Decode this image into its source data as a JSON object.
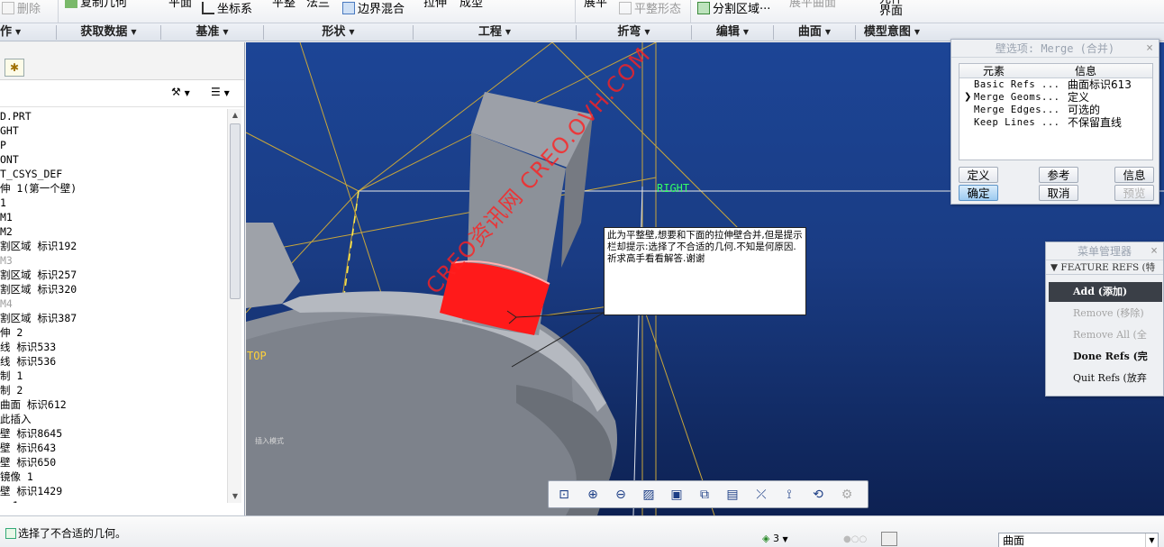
{
  "ribbon": {
    "delete": "删除",
    "copy_geometry": "复制几何",
    "plane": "平面",
    "csys": "坐标系",
    "flat": "平整",
    "method": "法兰",
    "boundary_blend": "边界混合",
    "extrude": "拉伸",
    "form": "成型",
    "bend": "展平",
    "flat_form": "平整形态",
    "split_region": "分割区域···",
    "unbend": "展平曲面",
    "interface_line1": "元件",
    "interface_line2": "界面"
  },
  "groups": [
    {
      "label": "作"
    },
    {
      "label": "获取数据"
    },
    {
      "label": "基准"
    },
    {
      "label": "形状"
    },
    {
      "label": "工程"
    },
    {
      "label": "折弯"
    },
    {
      "label": "编辑"
    },
    {
      "label": "曲面"
    },
    {
      "label": "模型意图"
    }
  ],
  "tree": {
    "rows": [
      {
        "text": "D.PRT"
      },
      {
        "text": "GHT"
      },
      {
        "text": "P"
      },
      {
        "text": "ONT"
      },
      {
        "text": "T_CSYS_DEF"
      },
      {
        "text": "伸 1(第一个壁)"
      },
      {
        "text": "1"
      },
      {
        "text": "M1"
      },
      {
        "text": "M2"
      },
      {
        "text": "割区域 标识192"
      },
      {
        "text": "M3"
      },
      {
        "text": "割区域 标识257"
      },
      {
        "text": "割区域 标识320"
      },
      {
        "text": "M4"
      },
      {
        "text": "割区域 标识387"
      },
      {
        "text": "伸 2"
      },
      {
        "text": "线 标识533"
      },
      {
        "text": "线 标识536"
      },
      {
        "text": "制 1"
      },
      {
        "text": "制 2"
      },
      {
        "text": "曲面 标识612"
      },
      {
        "text": "此插入"
      },
      {
        "text": "壁 标识8645"
      },
      {
        "text": "壁 标识643"
      },
      {
        "text": "壁 标识650"
      },
      {
        "text": "镜像 1"
      },
      {
        "text": "壁 标识1429"
      },
      {
        "text": "· 1"
      }
    ]
  },
  "viewport": {
    "note": "此为平整壁,想要和下面的拉伸壁合并,但是提示栏却提示:选择了不合适的几何.不知是何原因.祈求高手看看解答.谢谢",
    "watermark": "CREO资讯网 CREO.OVH.COM",
    "plane_right": "RIGHT",
    "plane_top": "TOP",
    "tiny_label": "插入模式"
  },
  "wall_dialog": {
    "title": "壁选项: Merge (合并)",
    "col_element": "元素",
    "col_info": "信息",
    "rows": [
      {
        "element": "Basic Refs ...",
        "info": "曲面标识613"
      },
      {
        "element": "Merge Geoms...",
        "info": "定义"
      },
      {
        "element": "Merge Edges...",
        "info": "可选的"
      },
      {
        "element": "Keep Lines ...",
        "info": "不保留直线"
      }
    ],
    "btn_define": "定义",
    "btn_refs": "参考",
    "btn_info": "信息",
    "btn_ok": "确定",
    "btn_cancel": "取消",
    "btn_preview": "预览"
  },
  "menu_dialog": {
    "title": "菜单管理器",
    "section": "▼ FEATURE REFS (特",
    "items": [
      {
        "label": "Add (添加)"
      },
      {
        "label": "Remove (移除)"
      },
      {
        "label": "Remove All (全"
      },
      {
        "label": "Done Refs (完"
      },
      {
        "label": "Quit Refs (放弃"
      }
    ]
  },
  "status": {
    "message": "选择了不合适的几何。",
    "sel_count": "3",
    "filter": "曲面"
  },
  "colors": {
    "viewport_top": "#1c4596",
    "viewport_bottom": "#0d2152",
    "highlight": "#ff1a1a",
    "model_gray": "#8a8f98"
  }
}
